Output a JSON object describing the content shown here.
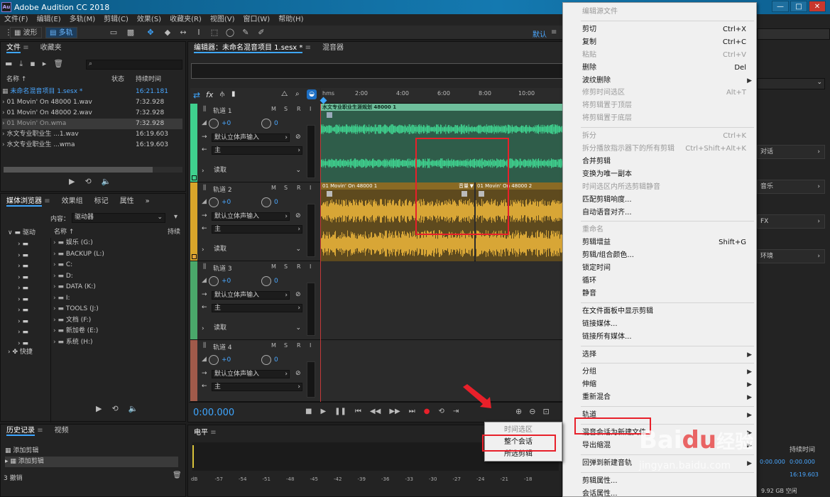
{
  "app": {
    "title": "Adobe Audition CC 2018",
    "logo": "Au"
  },
  "window_controls": [
    "—",
    "□",
    "✕"
  ],
  "menu": [
    "文件(F)",
    "编辑(E)",
    "多轨(M)",
    "剪辑(C)",
    "效果(S)",
    "收藏夹(R)",
    "视图(V)",
    "窗口(W)",
    "帮助(H)"
  ],
  "toolbar": {
    "waveform": "波形",
    "multitrack": "多轨",
    "workspace": "默认"
  },
  "files_panel": {
    "tabs": [
      "文件",
      "收藏夹"
    ],
    "search_placeholder": "",
    "cols": [
      "名称 ↑",
      "状态",
      "持续时间"
    ],
    "rows": [
      {
        "name": "未命名混音项目 1.sesx *",
        "dur": "16:21.181"
      },
      {
        "name": "01 Movin' On 48000 1.wav",
        "dur": "7:32.928"
      },
      {
        "name": "01 Movin' On 48000 2.wav",
        "dur": "7:32.928"
      },
      {
        "name": "01 Movin' On.wma",
        "dur": "7:32.928"
      },
      {
        "name": "水文专业职业生 ...1.wav",
        "dur": "16:19.603"
      },
      {
        "name": "水文专业职业生 ...wma",
        "dur": "16:19.603"
      }
    ]
  },
  "media_panel": {
    "tabs": [
      "媒体浏览器",
      "效果组",
      "标记",
      "属性"
    ],
    "content_label": "内容：",
    "content_value": "驱动器",
    "col_name": "名称 ↑",
    "col_dur": "持续",
    "left_root": "驱动",
    "left_last": "快捷",
    "drives": [
      "娱乐 (G:)",
      "BACKUP (L:)",
      "C:",
      "D:",
      "DATA (K:)",
      "I:",
      "TOOLS (J:)",
      "文档 (F:)",
      "新加卷 (E:)",
      "系统 (H:)"
    ]
  },
  "history_panel": {
    "tabs": [
      "历史记录",
      "视频"
    ],
    "items": [
      "添加剪辑",
      "添加剪辑"
    ],
    "undo": "3 撤销"
  },
  "editor": {
    "tab": "编辑器：未命名混音项目 1.sesx *",
    "tab2": "混音器",
    "ruler_unit": "hms",
    "ruler": [
      "2:00",
      "4:00",
      "6:00",
      "8:00",
      "10:00"
    ],
    "time": "0:00.000",
    "tracks": [
      {
        "name": "轨道 1",
        "vol": "+0",
        "pan": "0",
        "input": "默认立体声输入",
        "output": "主",
        "mode": "读取",
        "color": "#3fd08e"
      },
      {
        "name": "轨道 2",
        "vol": "+0",
        "pan": "0",
        "input": "默认立体声输入",
        "output": "主",
        "mode": "读取",
        "color": "#d9a52a"
      },
      {
        "name": "轨道 3",
        "vol": "+0",
        "pan": "0",
        "input": "默认立体声输入",
        "output": "主",
        "mode": "读取",
        "color": "#4aa86a"
      },
      {
        "name": "轨道 4",
        "vol": "+0",
        "pan": "0",
        "input": "默认立体声输入",
        "output": "主",
        "mode": "",
        "color": "#a05a4a"
      }
    ],
    "clip1": "水文专业职业生涯规划 48000 1",
    "clip2a": "01 Movin' On 48000 1",
    "clip2b": "01 Movin' On 48000 2",
    "clip2_vol": "音量"
  },
  "levels": {
    "title": "电平",
    "scale": [
      "dB",
      "-57",
      "-54",
      "-51",
      "-48",
      "-45",
      "-42",
      "-39",
      "-36",
      "-33",
      "-30",
      "-27",
      "-24",
      "-21",
      "-18"
    ]
  },
  "right_panel": {
    "items": [
      "对话",
      "音乐",
      "FX",
      "环境"
    ],
    "dur_label": "持续时间",
    "vals": [
      "0:00.000",
      "0:00.000",
      "16:19.603"
    ],
    "disk": "9.92 GB 空闲"
  },
  "context_menu": [
    {
      "label": "编辑源文件",
      "disabled": true
    },
    {
      "sep": true
    },
    {
      "label": "剪切",
      "shortcut": "Ctrl+X"
    },
    {
      "label": "复制",
      "shortcut": "Ctrl+C"
    },
    {
      "label": "粘贴",
      "shortcut": "Ctrl+V",
      "disabled": true
    },
    {
      "label": "删除",
      "shortcut": "Del"
    },
    {
      "label": "波纹删除",
      "arrow": true
    },
    {
      "label": "修剪时间选区",
      "shortcut": "Alt+T",
      "disabled": true
    },
    {
      "label": "将剪辑置于顶层",
      "disabled": true
    },
    {
      "label": "将剪辑置于底层",
      "disabled": true
    },
    {
      "sep": true
    },
    {
      "label": "拆分",
      "shortcut": "Ctrl+K",
      "disabled": true
    },
    {
      "label": "拆分播放指示器下的所有剪辑",
      "shortcut": "Ctrl+Shift+Alt+K",
      "disabled": true
    },
    {
      "label": "合并剪辑"
    },
    {
      "label": "变换为唯一副本"
    },
    {
      "label": "时间选区内所选剪辑静音",
      "disabled": true
    },
    {
      "label": "匹配剪辑响度..."
    },
    {
      "label": "自动语音对齐..."
    },
    {
      "sep": true
    },
    {
      "label": "重命名",
      "disabled": true
    },
    {
      "label": "剪辑增益",
      "shortcut": "Shift+G"
    },
    {
      "label": "剪辑/组合颜色..."
    },
    {
      "label": "锁定时间"
    },
    {
      "label": "循环"
    },
    {
      "label": "静音"
    },
    {
      "sep": true
    },
    {
      "label": "在文件面板中显示剪辑"
    },
    {
      "label": "链接媒体..."
    },
    {
      "label": "链接所有媒体..."
    },
    {
      "sep": true
    },
    {
      "label": "选择",
      "arrow": true
    },
    {
      "sep": true
    },
    {
      "label": "分组",
      "arrow": true
    },
    {
      "label": "伸缩",
      "arrow": true
    },
    {
      "label": "重新混合",
      "arrow": true
    },
    {
      "sep": true
    },
    {
      "label": "轨道",
      "arrow": true
    },
    {
      "sep": true
    },
    {
      "label": "混音会话为新建文件",
      "arrow": true
    },
    {
      "label": "导出缩混",
      "arrow": true
    },
    {
      "sep": true
    },
    {
      "label": "回弹到新建音轨",
      "arrow": true
    },
    {
      "sep": true
    },
    {
      "label": "剪辑属性..."
    },
    {
      "label": "会话属性..."
    }
  ],
  "submenu": [
    {
      "label": "时间选区",
      "disabled": true
    },
    {
      "label": "整个会话"
    },
    {
      "label": "所选剪辑"
    }
  ],
  "watermark": {
    "brand": "Bai",
    "paw": "du",
    "cn": "经验",
    "url": "jingyan.baidu.com"
  }
}
